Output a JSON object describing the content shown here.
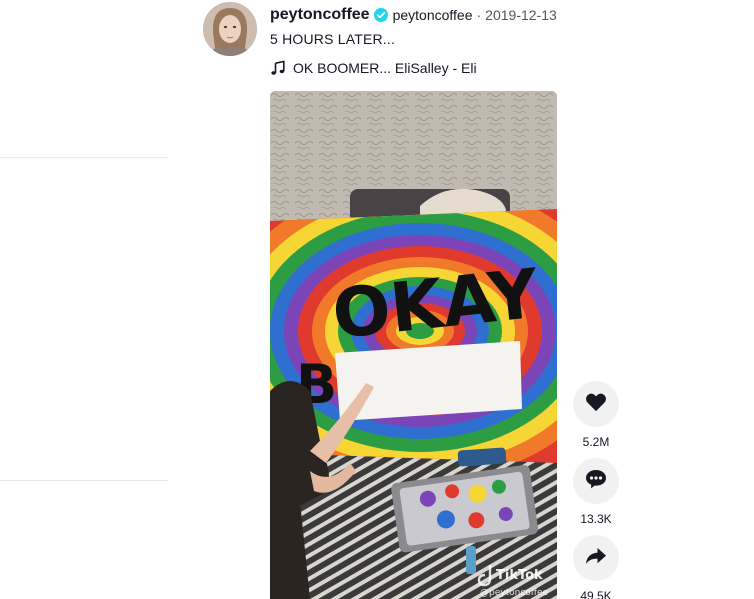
{
  "post": {
    "author_name": "peytoncoffee",
    "author_handle": "peytoncoffee",
    "separator": "·",
    "date": "2019-12-13",
    "caption": "5 HOURS LATER...",
    "music": "OK BOOMER... EliSalley - Eli"
  },
  "video": {
    "painted_word_1": "OKAY",
    "painted_word_2": "B",
    "watermark_brand": "TikTok",
    "watermark_handle": "@peytoncoffee"
  },
  "actions": {
    "likes": "5.2M",
    "comments": "13.3K",
    "shares": "49.5K"
  },
  "colors": {
    "verified": "#20d5ec",
    "action_bg": "#f1f1f2",
    "text": "#161823"
  },
  "icons": [
    "verified-icon",
    "music-note-icon",
    "heart-icon",
    "comment-icon",
    "share-icon"
  ]
}
